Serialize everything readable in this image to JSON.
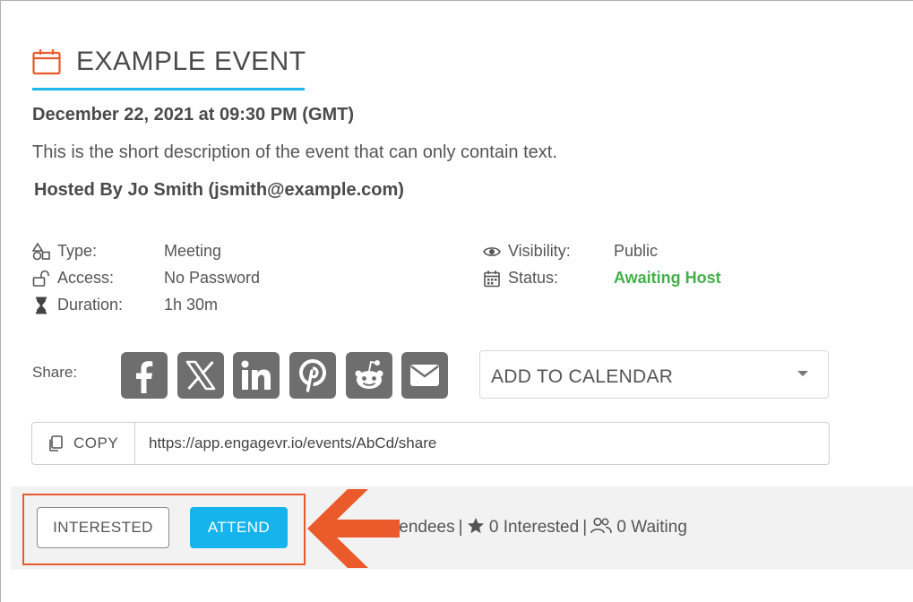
{
  "event": {
    "title": "EXAMPLE EVENT",
    "date": "December 22, 2021 at 09:30 PM (GMT)",
    "description": "This is the short description of the event that can only contain text.",
    "host": "Hosted By Jo Smith (jsmith@example.com)"
  },
  "details": {
    "type_label": "Type:",
    "type_value": "Meeting",
    "access_label": "Access:",
    "access_value": "No Password",
    "duration_label": "Duration:",
    "duration_value": "1h 30m",
    "visibility_label": "Visibility:",
    "visibility_value": "Public",
    "status_label": "Status:",
    "status_value": "Awaiting Host"
  },
  "share": {
    "label": "Share:",
    "buttons": [
      "facebook-icon",
      "x-icon",
      "linkedin-icon",
      "pinterest-icon",
      "reddit-icon",
      "email-icon"
    ],
    "calendar_label": "ADD TO CALENDAR",
    "copy_label": "COPY",
    "url": "https://app.engagevr.io/events/AbCd/share"
  },
  "actions": {
    "interested_label": "INTERESTED",
    "attend_label": "ATTEND"
  },
  "stats": {
    "attendees_text": "tendees",
    "interested_text": "0 Interested",
    "waiting_text": "0 Waiting"
  },
  "colors": {
    "accent": "#1fb6ea",
    "attend_button": "#16b4ec",
    "status": "#43b04a",
    "highlight": "#ea5a2a",
    "share_button": "#6e6e6e"
  }
}
